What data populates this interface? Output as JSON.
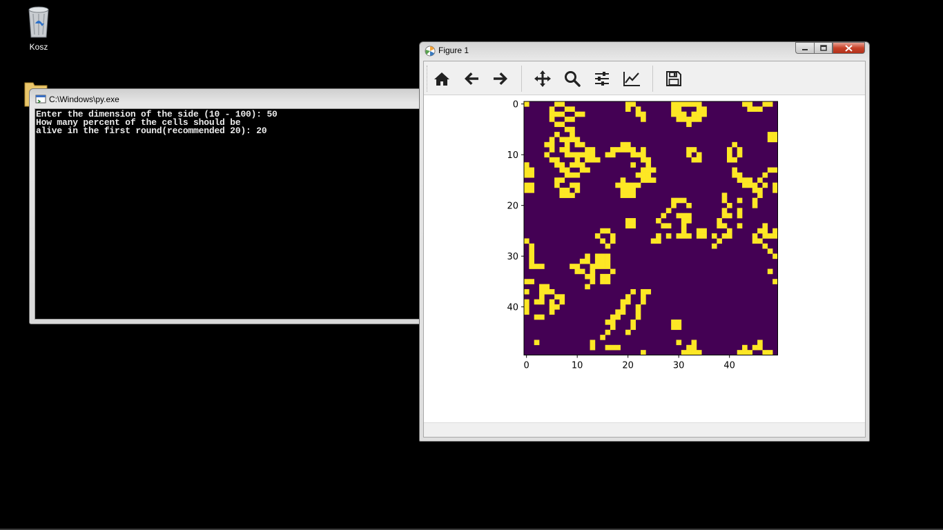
{
  "desktop": {
    "recycle_bin_label": "Kosz"
  },
  "console": {
    "title": "C:\\Windows\\py.exe",
    "lines": [
      "Enter the dimension of the side (10 - 100): 50",
      "How many percent of the cells should be",
      "alive in the first round(recommended 20): 20"
    ]
  },
  "figure": {
    "title": "Figure 1",
    "toolbar": [
      {
        "name": "home-icon",
        "tooltip": "Home"
      },
      {
        "name": "back-icon",
        "tooltip": "Back"
      },
      {
        "name": "forward-icon",
        "tooltip": "Forward"
      },
      {
        "name": "pan-icon",
        "tooltip": "Pan"
      },
      {
        "name": "zoom-icon",
        "tooltip": "Zoom"
      },
      {
        "name": "configure-subplots-icon",
        "tooltip": "Subplots"
      },
      {
        "name": "edit-axis-icon",
        "tooltip": "Customize"
      },
      {
        "name": "save-icon",
        "tooltip": "Save"
      }
    ]
  },
  "chart_data": {
    "type": "heatmap",
    "size": 50,
    "x_ticks": [
      "0",
      "10",
      "20",
      "30",
      "40"
    ],
    "y_ticks": [
      "0",
      "10",
      "20",
      "30",
      "40"
    ],
    "colors": {
      "dead": "#440154",
      "alive": "#fde725"
    },
    "alive_cells": [
      [
        0,
        0
      ],
      [
        0,
        6
      ],
      [
        0,
        7
      ],
      [
        0,
        20
      ],
      [
        0,
        21
      ],
      [
        0,
        29
      ],
      [
        0,
        30
      ],
      [
        0,
        31
      ],
      [
        0,
        32
      ],
      [
        0,
        33
      ],
      [
        0,
        34
      ],
      [
        0,
        43
      ],
      [
        0,
        44
      ],
      [
        0,
        47
      ],
      [
        0,
        48
      ],
      [
        1,
        5
      ],
      [
        1,
        8
      ],
      [
        1,
        9
      ],
      [
        1,
        20
      ],
      [
        1,
        22
      ],
      [
        1,
        29
      ],
      [
        1,
        30
      ],
      [
        1,
        34
      ],
      [
        1,
        35
      ],
      [
        1,
        44
      ],
      [
        1,
        45
      ],
      [
        1,
        46
      ],
      [
        2,
        5
      ],
      [
        2,
        6
      ],
      [
        2,
        7
      ],
      [
        2,
        10
      ],
      [
        2,
        11
      ],
      [
        2,
        22
      ],
      [
        2,
        23
      ],
      [
        2,
        29
      ],
      [
        2,
        30
      ],
      [
        2,
        31
      ],
      [
        2,
        33
      ],
      [
        2,
        34
      ],
      [
        2,
        35
      ],
      [
        3,
        5
      ],
      [
        3,
        8
      ],
      [
        3,
        9
      ],
      [
        3,
        23
      ],
      [
        3,
        30
      ],
      [
        3,
        31
      ],
      [
        3,
        32
      ],
      [
        3,
        33
      ],
      [
        3,
        34
      ],
      [
        4,
        6
      ],
      [
        4,
        7
      ],
      [
        4,
        32
      ],
      [
        5,
        8
      ],
      [
        5,
        9
      ],
      [
        6,
        6
      ],
      [
        6,
        9
      ],
      [
        6,
        48
      ],
      [
        6,
        49
      ],
      [
        7,
        5
      ],
      [
        7,
        7
      ],
      [
        7,
        8
      ],
      [
        7,
        9
      ],
      [
        7,
        10
      ],
      [
        7,
        48
      ],
      [
        7,
        49
      ],
      [
        8,
        4
      ],
      [
        8,
        5
      ],
      [
        8,
        8
      ],
      [
        8,
        10
      ],
      [
        8,
        11
      ],
      [
        8,
        19
      ],
      [
        8,
        20
      ],
      [
        8,
        41
      ],
      [
        9,
        5
      ],
      [
        9,
        7
      ],
      [
        9,
        8
      ],
      [
        9,
        12
      ],
      [
        9,
        13
      ],
      [
        9,
        17
      ],
      [
        9,
        18
      ],
      [
        9,
        19
      ],
      [
        9,
        20
      ],
      [
        9,
        21
      ],
      [
        9,
        23
      ],
      [
        9,
        32
      ],
      [
        9,
        33
      ],
      [
        9,
        40
      ],
      [
        9,
        42
      ],
      [
        10,
        4
      ],
      [
        10,
        8
      ],
      [
        10,
        9
      ],
      [
        10,
        10
      ],
      [
        10,
        11
      ],
      [
        10,
        12
      ],
      [
        10,
        13
      ],
      [
        10,
        16
      ],
      [
        10,
        17
      ],
      [
        10,
        21
      ],
      [
        10,
        22
      ],
      [
        10,
        23
      ],
      [
        10,
        32
      ],
      [
        10,
        34
      ],
      [
        10,
        40
      ],
      [
        10,
        42
      ],
      [
        11,
        5
      ],
      [
        11,
        6
      ],
      [
        11,
        10
      ],
      [
        11,
        12
      ],
      [
        11,
        13
      ],
      [
        11,
        14
      ],
      [
        11,
        23
      ],
      [
        11,
        24
      ],
      [
        11,
        33
      ],
      [
        11,
        34
      ],
      [
        11,
        40
      ],
      [
        11,
        41
      ],
      [
        12,
        0
      ],
      [
        12,
        6
      ],
      [
        12,
        7
      ],
      [
        12,
        9
      ],
      [
        12,
        10
      ],
      [
        12,
        11
      ],
      [
        12,
        21
      ],
      [
        12,
        24
      ],
      [
        13,
        0
      ],
      [
        13,
        1
      ],
      [
        13,
        7
      ],
      [
        13,
        8
      ],
      [
        13,
        11
      ],
      [
        13,
        12
      ],
      [
        13,
        23
      ],
      [
        13,
        24
      ],
      [
        13,
        25
      ],
      [
        13,
        41
      ],
      [
        13,
        48
      ],
      [
        13,
        49
      ],
      [
        14,
        0
      ],
      [
        14,
        1
      ],
      [
        14,
        8
      ],
      [
        14,
        9
      ],
      [
        14,
        10
      ],
      [
        14,
        22
      ],
      [
        14,
        23
      ],
      [
        14,
        24
      ],
      [
        14,
        41
      ],
      [
        14,
        42
      ],
      [
        14,
        47
      ],
      [
        15,
        6
      ],
      [
        15,
        7
      ],
      [
        15,
        19
      ],
      [
        15,
        23
      ],
      [
        15,
        24
      ],
      [
        15,
        25
      ],
      [
        15,
        42
      ],
      [
        15,
        43
      ],
      [
        15,
        44
      ],
      [
        15,
        46
      ],
      [
        16,
        0
      ],
      [
        16,
        1
      ],
      [
        16,
        6
      ],
      [
        16,
        9
      ],
      [
        16,
        10
      ],
      [
        16,
        18
      ],
      [
        16,
        19
      ],
      [
        16,
        20
      ],
      [
        16,
        21
      ],
      [
        16,
        22
      ],
      [
        16,
        43
      ],
      [
        16,
        44
      ],
      [
        16,
        45
      ],
      [
        16,
        47
      ],
      [
        16,
        49
      ],
      [
        17,
        0
      ],
      [
        17,
        1
      ],
      [
        17,
        7
      ],
      [
        17,
        8
      ],
      [
        17,
        10
      ],
      [
        17,
        19
      ],
      [
        17,
        20
      ],
      [
        17,
        21
      ],
      [
        17,
        45
      ],
      [
        17,
        46
      ],
      [
        17,
        49
      ],
      [
        18,
        7
      ],
      [
        18,
        8
      ],
      [
        18,
        9
      ],
      [
        18,
        19
      ],
      [
        18,
        20
      ],
      [
        18,
        21
      ],
      [
        18,
        39
      ],
      [
        18,
        46
      ],
      [
        19,
        29
      ],
      [
        19,
        30
      ],
      [
        19,
        31
      ],
      [
        19,
        39
      ],
      [
        19,
        42
      ],
      [
        19,
        45
      ],
      [
        20,
        29
      ],
      [
        20,
        32
      ],
      [
        20,
        40
      ],
      [
        20,
        45
      ],
      [
        21,
        28
      ],
      [
        21,
        39
      ],
      [
        21,
        42
      ],
      [
        22,
        27
      ],
      [
        22,
        30
      ],
      [
        22,
        31
      ],
      [
        22,
        32
      ],
      [
        22,
        39
      ],
      [
        22,
        40
      ],
      [
        22,
        42
      ],
      [
        23,
        20
      ],
      [
        23,
        21
      ],
      [
        23,
        26
      ],
      [
        23,
        31
      ],
      [
        23,
        32
      ],
      [
        23,
        38
      ],
      [
        24,
        20
      ],
      [
        24,
        21
      ],
      [
        24,
        27
      ],
      [
        24,
        28
      ],
      [
        24,
        31
      ],
      [
        24,
        38
      ],
      [
        24,
        39
      ],
      [
        24,
        42
      ],
      [
        24,
        47
      ],
      [
        25,
        15
      ],
      [
        25,
        16
      ],
      [
        25,
        31
      ],
      [
        25,
        34
      ],
      [
        25,
        35
      ],
      [
        25,
        40
      ],
      [
        25,
        46
      ],
      [
        25,
        47
      ],
      [
        25,
        49
      ],
      [
        26,
        14
      ],
      [
        26,
        17
      ],
      [
        26,
        26
      ],
      [
        26,
        28
      ],
      [
        26,
        30
      ],
      [
        26,
        31
      ],
      [
        26,
        32
      ],
      [
        26,
        34
      ],
      [
        26,
        35
      ],
      [
        26,
        37
      ],
      [
        26,
        39
      ],
      [
        26,
        40
      ],
      [
        26,
        45
      ],
      [
        26,
        47
      ],
      [
        26,
        48
      ],
      [
        26,
        49
      ],
      [
        27,
        0
      ],
      [
        27,
        15
      ],
      [
        27,
        17
      ],
      [
        27,
        25
      ],
      [
        27,
        26
      ],
      [
        27,
        38
      ],
      [
        27,
        45
      ],
      [
        27,
        46
      ],
      [
        28,
        1
      ],
      [
        28,
        16
      ],
      [
        28,
        37
      ],
      [
        28,
        47
      ],
      [
        29,
        1
      ],
      [
        29,
        48
      ],
      [
        30,
        1
      ],
      [
        30,
        12
      ],
      [
        30,
        14
      ],
      [
        30,
        15
      ],
      [
        30,
        16
      ],
      [
        30,
        49
      ],
      [
        31,
        1
      ],
      [
        31,
        11
      ],
      [
        31,
        12
      ],
      [
        31,
        14
      ],
      [
        31,
        15
      ],
      [
        31,
        16
      ],
      [
        32,
        1
      ],
      [
        32,
        2
      ],
      [
        32,
        3
      ],
      [
        32,
        9
      ],
      [
        32,
        10
      ],
      [
        32,
        13
      ],
      [
        32,
        14
      ],
      [
        32,
        15
      ],
      [
        32,
        16
      ],
      [
        33,
        10
      ],
      [
        33,
        11
      ],
      [
        33,
        13
      ],
      [
        33,
        17
      ],
      [
        33,
        48
      ],
      [
        34,
        12
      ],
      [
        34,
        13
      ],
      [
        34,
        15
      ],
      [
        34,
        16
      ],
      [
        35,
        0
      ],
      [
        35,
        1
      ],
      [
        35,
        13
      ],
      [
        35,
        15
      ],
      [
        35,
        16
      ],
      [
        35,
        49
      ],
      [
        36,
        3
      ],
      [
        36,
        4
      ],
      [
        36,
        12
      ],
      [
        37,
        0
      ],
      [
        37,
        3
      ],
      [
        37,
        4
      ],
      [
        37,
        5
      ],
      [
        37,
        21
      ],
      [
        37,
        23
      ],
      [
        37,
        24
      ],
      [
        38,
        3
      ],
      [
        38,
        6
      ],
      [
        38,
        7
      ],
      [
        38,
        20
      ],
      [
        38,
        23
      ],
      [
        39,
        0
      ],
      [
        39,
        2
      ],
      [
        39,
        3
      ],
      [
        39,
        5
      ],
      [
        39,
        7
      ],
      [
        39,
        19
      ],
      [
        39,
        20
      ],
      [
        39,
        23
      ],
      [
        40,
        0
      ],
      [
        40,
        5
      ],
      [
        40,
        6
      ],
      [
        40,
        19
      ],
      [
        40,
        22
      ],
      [
        41,
        0
      ],
      [
        41,
        5
      ],
      [
        41,
        18
      ],
      [
        41,
        19
      ],
      [
        41,
        22
      ],
      [
        42,
        2
      ],
      [
        42,
        3
      ],
      [
        42,
        17
      ],
      [
        42,
        18
      ],
      [
        42,
        22
      ],
      [
        43,
        16
      ],
      [
        43,
        17
      ],
      [
        43,
        21
      ],
      [
        43,
        29
      ],
      [
        43,
        30
      ],
      [
        44,
        17
      ],
      [
        44,
        21
      ],
      [
        44,
        29
      ],
      [
        44,
        30
      ],
      [
        45,
        16
      ],
      [
        45,
        20
      ],
      [
        46,
        15
      ],
      [
        47,
        2
      ],
      [
        47,
        13
      ],
      [
        47,
        30
      ],
      [
        47,
        33
      ],
      [
        47,
        46
      ],
      [
        48,
        13
      ],
      [
        48,
        16
      ],
      [
        48,
        17
      ],
      [
        48,
        18
      ],
      [
        48,
        32
      ],
      [
        48,
        33
      ],
      [
        48,
        43
      ],
      [
        48,
        45
      ],
      [
        48,
        46
      ],
      [
        49,
        23
      ],
      [
        49,
        31
      ],
      [
        49,
        32
      ],
      [
        49,
        33
      ],
      [
        49,
        34
      ],
      [
        49,
        42
      ],
      [
        49,
        43
      ],
      [
        49,
        44
      ],
      [
        49,
        47
      ],
      [
        49,
        48
      ]
    ]
  }
}
